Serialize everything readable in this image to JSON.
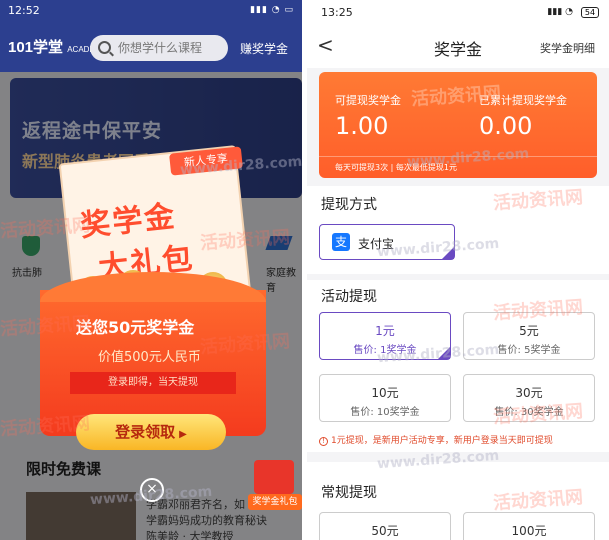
{
  "left": {
    "status": {
      "time": "12:52"
    },
    "header": {
      "logo": "101学堂",
      "logo_sub": "ACADEMY",
      "search_placeholder": "你想学什么课程",
      "earn_link": "赚奖学金"
    },
    "banner": {
      "line1": "返程途中保平安",
      "line2": "新型肺炎患者同乘"
    },
    "icons": [
      {
        "label": "抗击肺"
      },
      {
        "label": "家庭教育"
      }
    ],
    "popup": {
      "tag": "新人专享",
      "big_line1": "奖学金",
      "big_line2": "大礼包",
      "send_text": "送您50元奖学金",
      "worth_text": "价值500元人民币",
      "strip_text": "登录即得，当天提现",
      "button_label": "登录领取",
      "close_symbol": "×"
    },
    "free_title": "限时免费课",
    "course_card": {
      "line1": "学霸邓丽君齐名，如",
      "line2": "学霸妈妈成功的教育秘诀",
      "line3": "陈美龄 · 大学教授"
    },
    "gift_badge": {
      "label": "奖学金礼包"
    }
  },
  "right": {
    "status": {
      "time": "13:25",
      "battery": "54"
    },
    "nav": {
      "title": "奖学金",
      "detail_link": "奖学金明细",
      "back_symbol": "<"
    },
    "summary": {
      "withdrawable_label": "可提现奖学金",
      "withdrawable_value": "1.00",
      "total_label": "已累计提现奖学金",
      "total_value": "0.00",
      "footnote": "每天可提现3次 | 每次最低提现1元"
    },
    "method": {
      "title": "提现方式",
      "option_label": "支付宝",
      "option_icon_char": "支"
    },
    "activity": {
      "title": "活动提现",
      "options": [
        {
          "value": "1元",
          "sub": "售价: 1奖学金",
          "selected": true
        },
        {
          "value": "5元",
          "sub": "售价: 5奖学金",
          "selected": false
        },
        {
          "value": "10元",
          "sub": "售价: 10奖学金",
          "selected": false
        },
        {
          "value": "30元",
          "sub": "售价: 30奖学金",
          "selected": false
        }
      ],
      "notice": "1元提现，是新用户活动专享，新用户登录当天即可提现"
    },
    "regular": {
      "title": "常规提现",
      "options": [
        {
          "value": "50元"
        },
        {
          "value": "100元"
        }
      ]
    }
  },
  "watermarks": {
    "cn": "活动资讯网",
    "url": "www.dir28.com"
  },
  "colors": {
    "brand_navy": "#2c3f8f",
    "accent_orange": "#ff6a2e",
    "selected_purple": "#6a4ac2",
    "notice_red": "#e04b2c"
  }
}
